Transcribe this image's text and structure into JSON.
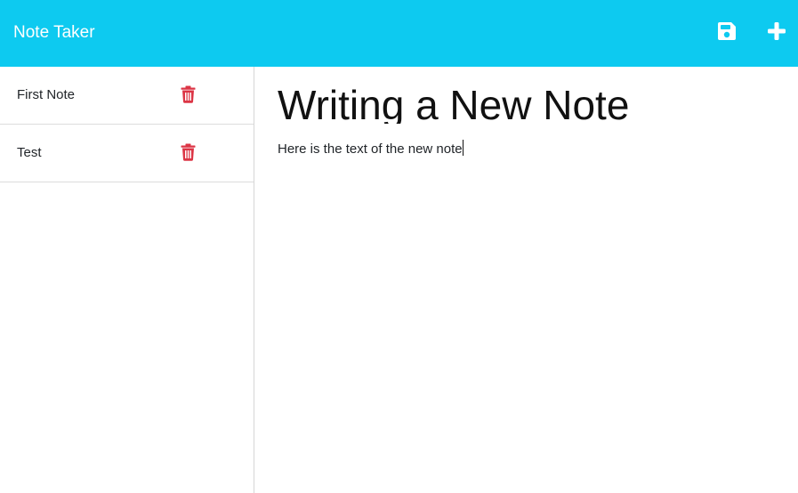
{
  "navbar": {
    "brand": "Note Taker",
    "save_icon": "save-icon",
    "add_icon": "plus-icon",
    "color": "#0dcaf0"
  },
  "sidebar": {
    "notes": [
      {
        "title": "First Note",
        "delete_icon": "trash-icon"
      },
      {
        "title": "Test",
        "delete_icon": "trash-icon"
      }
    ],
    "delete_color": "#dc3545"
  },
  "editor": {
    "title": "Writing a New Note",
    "text": "Here is the text of the new note"
  }
}
